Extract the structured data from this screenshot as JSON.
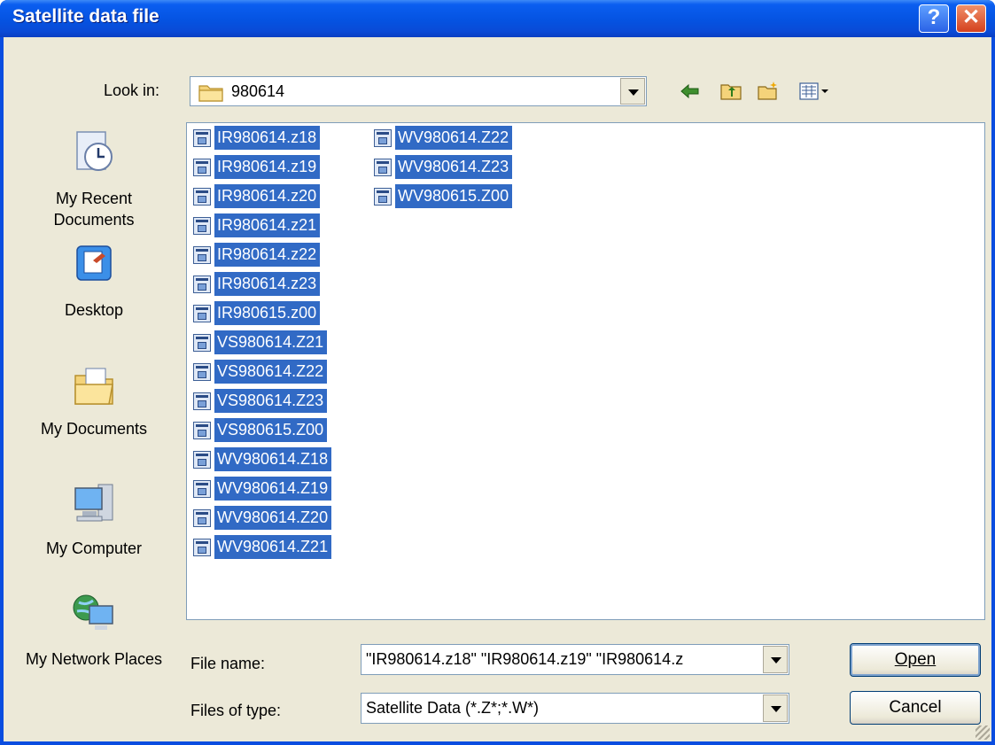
{
  "window": {
    "title": "Satellite data file",
    "help_glyph": "?",
    "close_glyph": "✕"
  },
  "look_in": {
    "label": "Look in:",
    "value": "980614"
  },
  "places": [
    {
      "label": "My Recent Documents",
      "icon": "recent-documents-icon"
    },
    {
      "label": "Desktop",
      "icon": "desktop-icon"
    },
    {
      "label": "My Documents",
      "icon": "my-documents-icon"
    },
    {
      "label": "My Computer",
      "icon": "my-computer-icon"
    },
    {
      "label": "My Network Places",
      "icon": "network-places-icon"
    }
  ],
  "files": [
    "IR980614.z18",
    "IR980614.z19",
    "IR980614.z20",
    "IR980614.z21",
    "IR980614.z22",
    "IR980614.z23",
    "IR980615.z00",
    "VS980614.Z21",
    "VS980614.Z22",
    "VS980614.Z23",
    "VS980615.Z00",
    "WV980614.Z18",
    "WV980614.Z19",
    "WV980614.Z20",
    "WV980614.Z21",
    "WV980614.Z22",
    "WV980614.Z23",
    "WV980615.Z00"
  ],
  "file_name": {
    "label": "File name:",
    "value": "\"IR980614.z18\" \"IR980614.z19\" \"IR980614.z"
  },
  "file_type": {
    "label": "Files of type:",
    "value": "Satellite Data (*.Z*;*.W*)"
  },
  "buttons": {
    "open": "Open",
    "cancel": "Cancel"
  },
  "colors": {
    "selection": "#316ac5",
    "titlebar": "#0553e1",
    "dialog": "#ece9d8"
  }
}
